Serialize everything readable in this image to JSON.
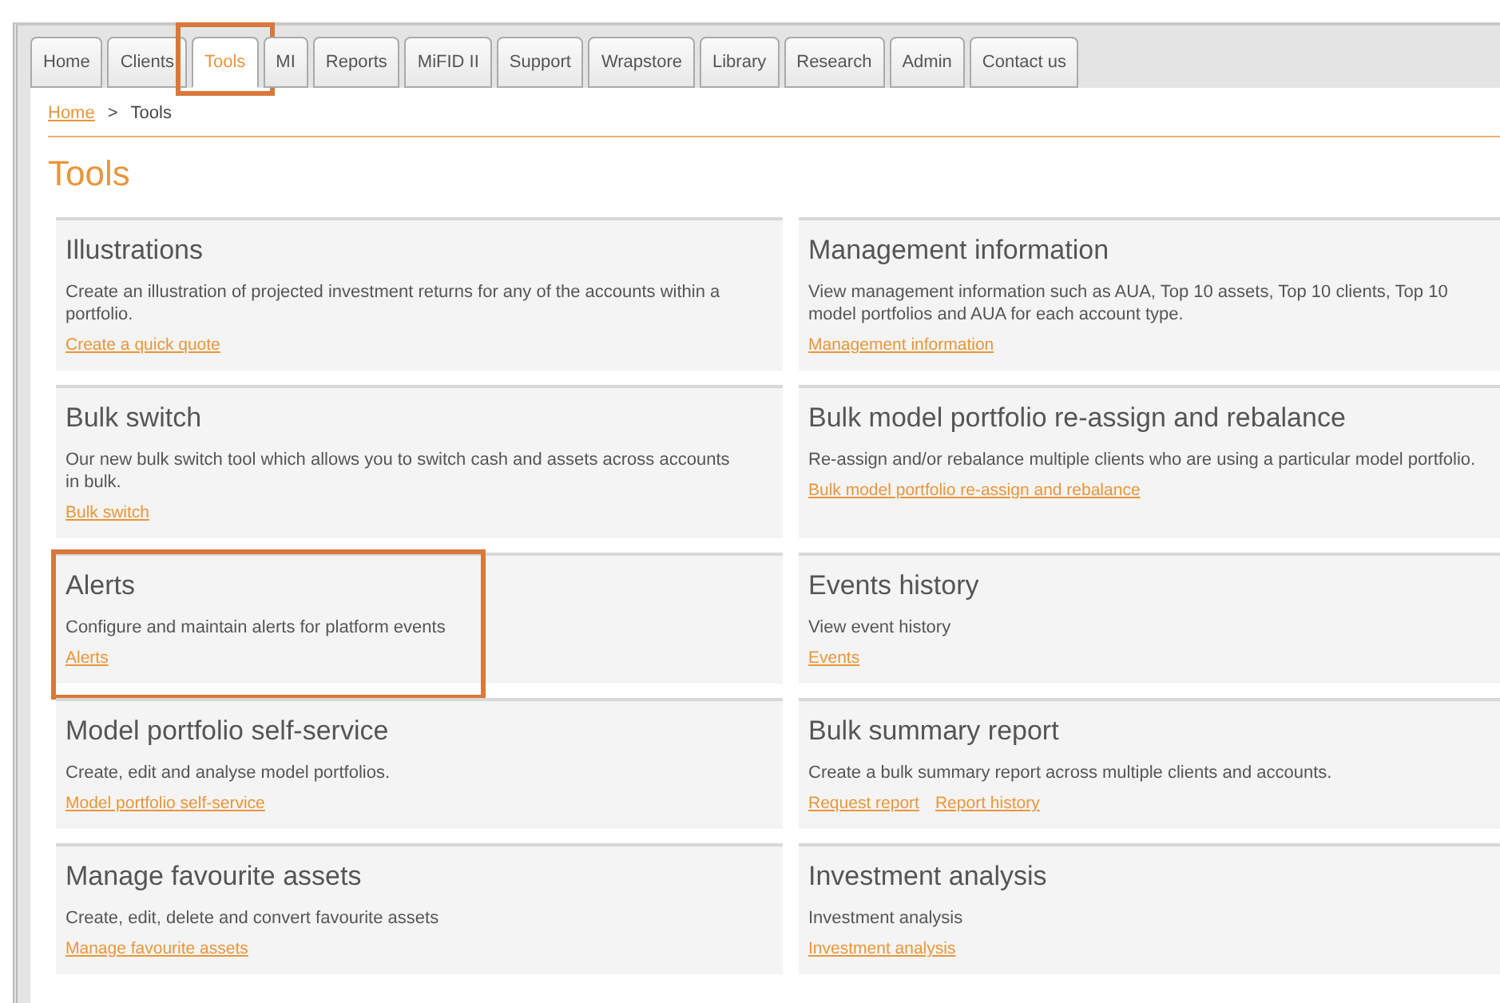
{
  "tabs": [
    {
      "label": "Home",
      "selected": false,
      "highlighted": false
    },
    {
      "label": "Clients",
      "selected": false,
      "highlighted": false
    },
    {
      "label": "Tools",
      "selected": true,
      "highlighted": true
    },
    {
      "label": "MI",
      "selected": false,
      "highlighted": false
    },
    {
      "label": "Reports",
      "selected": false,
      "highlighted": false
    },
    {
      "label": "MiFID II",
      "selected": false,
      "highlighted": false
    },
    {
      "label": "Support",
      "selected": false,
      "highlighted": false
    },
    {
      "label": "Wrapstore",
      "selected": false,
      "highlighted": false
    },
    {
      "label": "Library",
      "selected": false,
      "highlighted": false
    },
    {
      "label": "Research",
      "selected": false,
      "highlighted": false
    },
    {
      "label": "Admin",
      "selected": false,
      "highlighted": false
    },
    {
      "label": "Contact us",
      "selected": false,
      "highlighted": false
    }
  ],
  "breadcrumb": {
    "link": "Home",
    "separator": ">",
    "current": "Tools"
  },
  "page_title": "Tools",
  "cards": [
    {
      "title": "Illustrations",
      "description": "Create an illustration of projected investment returns for any of the accounts within a portfolio.",
      "links": [
        "Create a quick quote"
      ],
      "highlighted": false
    },
    {
      "title": "Management information",
      "description": "View management information such as AUA, Top 10 assets, Top 10 clients, Top 10 model portfolios and AUA for each account type.",
      "links": [
        "Management information"
      ],
      "highlighted": false
    },
    {
      "title": "Bulk switch",
      "description": "Our new bulk switch tool which allows you to switch cash and assets across accounts in bulk.",
      "links": [
        "Bulk switch"
      ],
      "highlighted": false
    },
    {
      "title": "Bulk model portfolio re-assign and rebalance",
      "description": "Re-assign and/or rebalance multiple clients who are using a particular model portfolio.",
      "links": [
        "Bulk model portfolio re-assign and rebalance"
      ],
      "highlighted": false
    },
    {
      "title": "Alerts",
      "description": "Configure and maintain alerts for platform events",
      "links": [
        "Alerts"
      ],
      "highlighted": true
    },
    {
      "title": "Events history",
      "description": "View event history",
      "links": [
        "Events"
      ],
      "highlighted": false
    },
    {
      "title": "Model portfolio self-service",
      "description": "Create, edit and analyse model portfolios.",
      "links": [
        "Model portfolio self-service"
      ],
      "highlighted": false
    },
    {
      "title": "Bulk summary report",
      "description": "Create a bulk summary report across multiple clients and accounts.",
      "links": [
        "Request report",
        "Report history"
      ],
      "highlighted": false
    },
    {
      "title": "Manage favourite assets",
      "description": "Create, edit, delete and convert favourite assets",
      "links": [
        "Manage favourite assets"
      ],
      "highlighted": false
    },
    {
      "title": "Investment analysis",
      "description": "Investment analysis",
      "links": [
        "Investment analysis"
      ],
      "highlighted": false
    }
  ]
}
